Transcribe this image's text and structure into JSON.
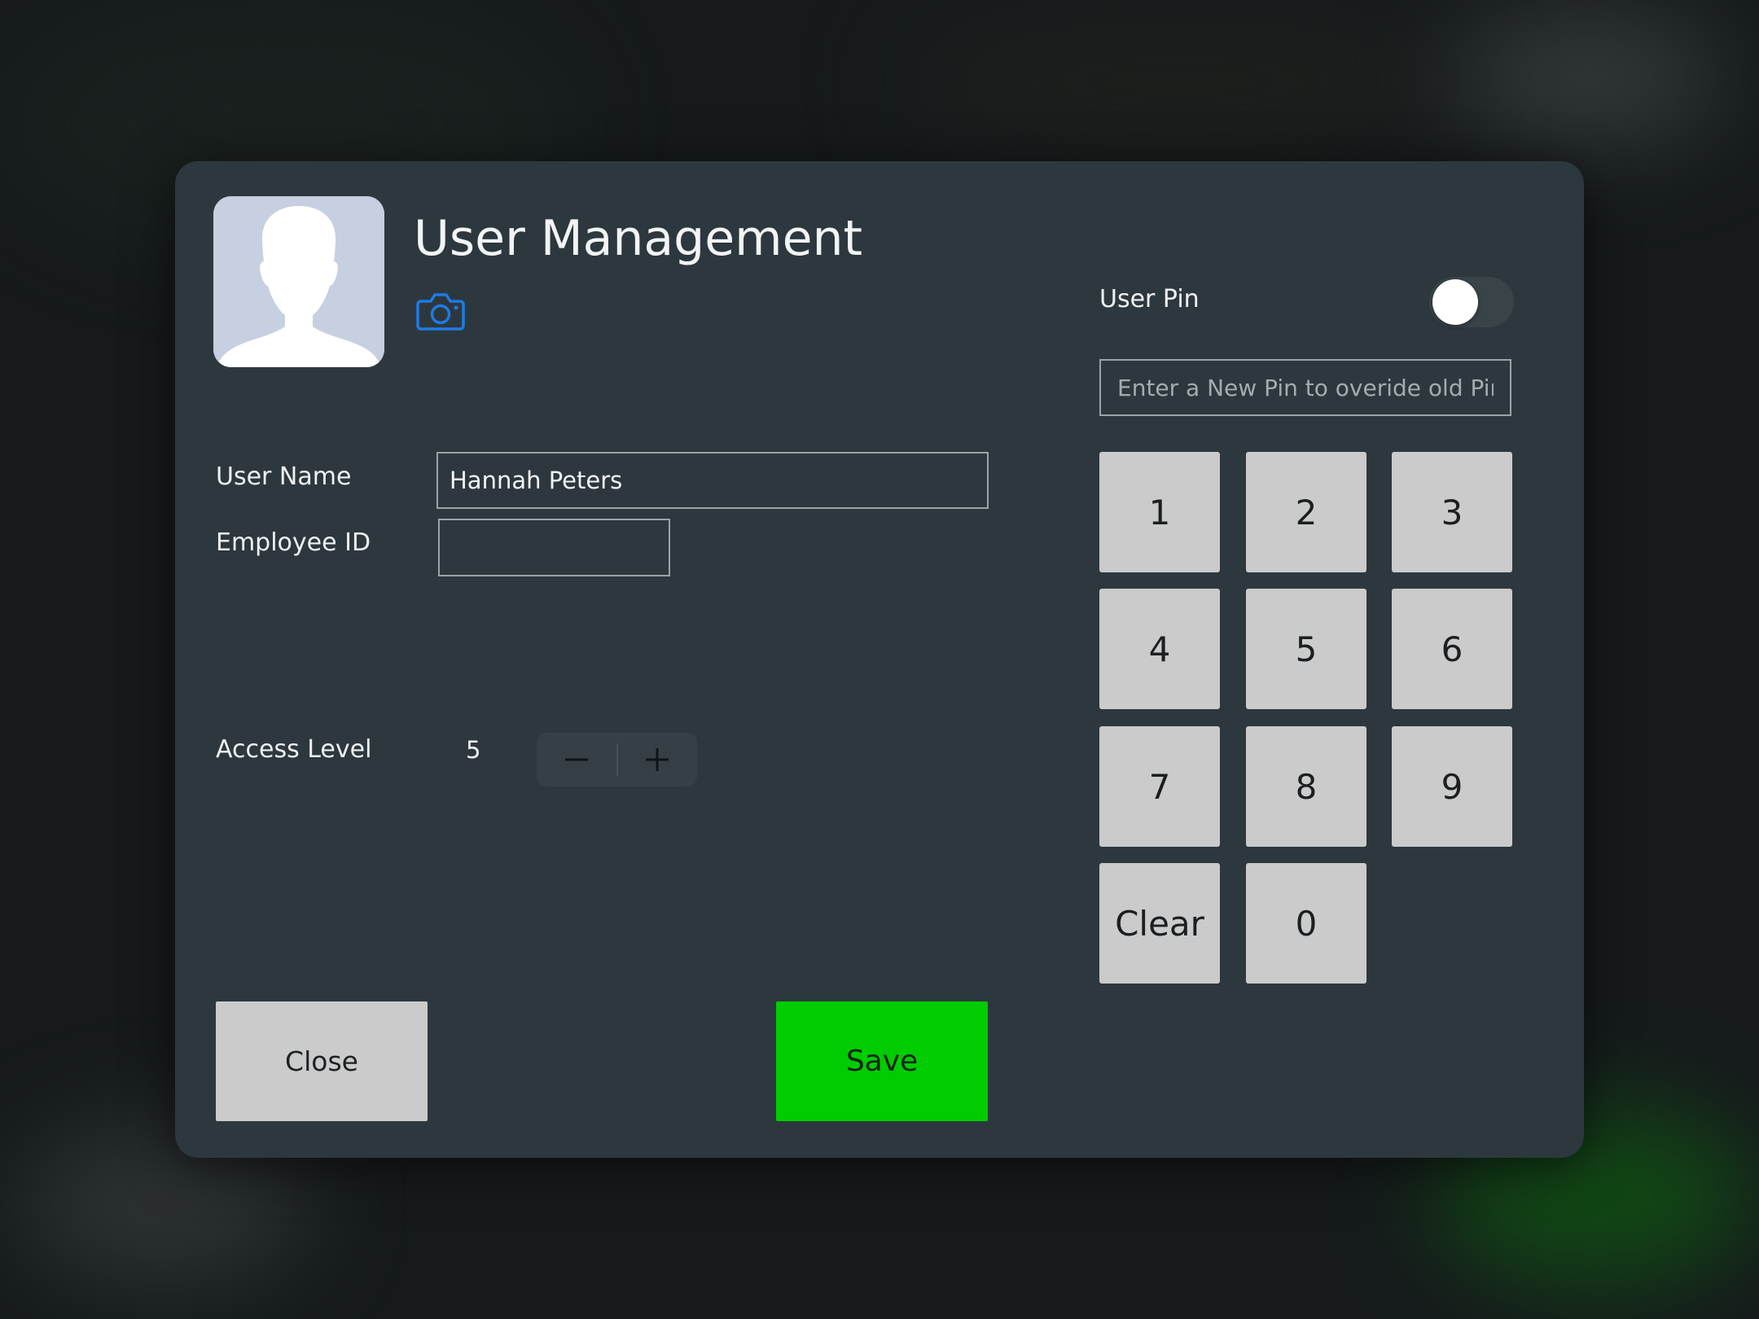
{
  "dialog": {
    "title": "User Management"
  },
  "form": {
    "username_label": "User Name",
    "username_value": "Hannah Peters",
    "employee_id_label": "Employee ID",
    "employee_id_value": "",
    "access_level_label": "Access Level",
    "access_level_value": "5"
  },
  "pin": {
    "label": "User Pin",
    "toggle_on": false,
    "placeholder": "Enter a New Pin to overide old Pin"
  },
  "keypad": {
    "k1": "1",
    "k2": "2",
    "k3": "3",
    "k4": "4",
    "k5": "5",
    "k6": "6",
    "k7": "7",
    "k8": "8",
    "k9": "9",
    "clear": "Clear",
    "k0": "0"
  },
  "actions": {
    "close_label": "Close",
    "save_label": "Save"
  },
  "colors": {
    "dialog_bg": "#2d383e",
    "save_green": "#00cc00",
    "key_gray": "#cbcbcb",
    "camera_blue": "#1e7be6",
    "avatar_bg": "#c7d0e1"
  },
  "icons": {
    "avatar": "person-silhouette-icon",
    "camera": "camera-icon",
    "minus": "minus-icon",
    "plus": "plus-icon"
  }
}
